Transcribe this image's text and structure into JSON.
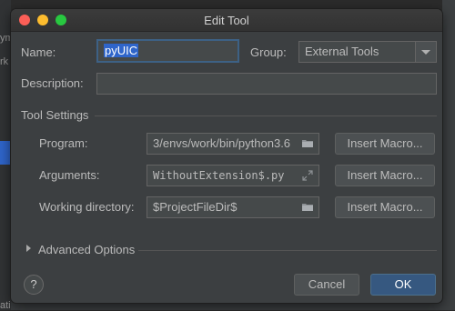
{
  "background": {
    "left_text": [
      "ym",
      "rk",
      "atic"
    ]
  },
  "dialog": {
    "title": "Edit Tool",
    "name_label": "Name:",
    "name_value": "pyUIC",
    "group_label": "Group:",
    "group_value": "External Tools",
    "description_label": "Description:",
    "description_value": "",
    "tool_settings_label": "Tool Settings",
    "program_label": "Program:",
    "program_value": "3/envs/work/bin/python3.6",
    "arguments_label": "Arguments:",
    "arguments_value": "WithoutExtension$.py",
    "working_dir_label": "Working directory:",
    "working_dir_value": "$ProjectFileDir$",
    "insert_macro_label": "Insert Macro...",
    "advanced_options_label": "Advanced Options",
    "help_label": "?",
    "cancel_label": "Cancel",
    "ok_label": "OK"
  },
  "colors": {
    "dialog_bg": "#3c3f41",
    "field_bg": "#45494a",
    "selection": "#2f65ca",
    "primary_button": "#365880",
    "traffic_close": "#fc5f57",
    "traffic_minimize": "#fdbc2e",
    "traffic_maximize": "#28c840"
  }
}
